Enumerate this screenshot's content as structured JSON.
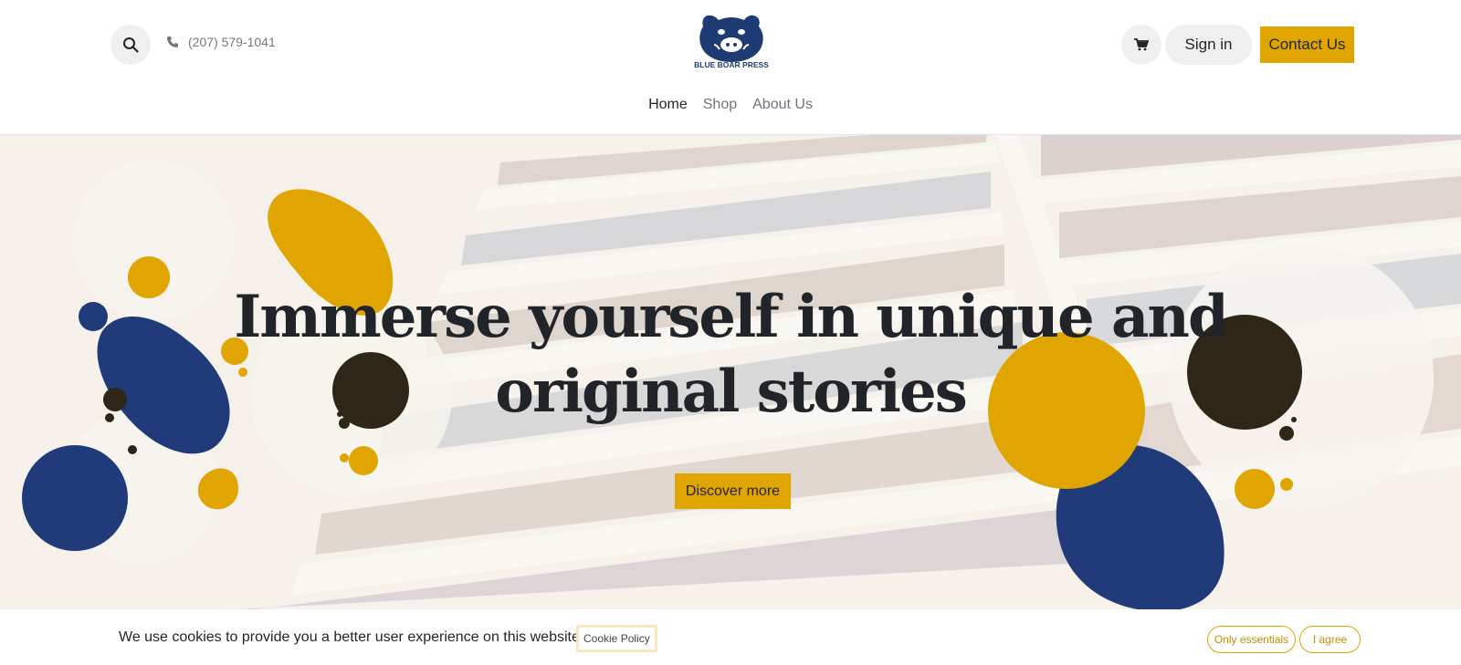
{
  "header": {
    "phone": "(207) 579-1041",
    "logo_text": "BLUE BOAR PRESS",
    "signin_label": "Sign in",
    "contact_label": "Contact Us",
    "icons": {
      "search": "search-icon",
      "phone": "phone-icon",
      "cart": "cart-icon"
    }
  },
  "nav": {
    "items": [
      {
        "label": "Home",
        "active": true
      },
      {
        "label": "Shop",
        "active": false
      },
      {
        "label": "About Us",
        "active": false
      }
    ]
  },
  "hero": {
    "title": "Immerse yourself in unique and original stories",
    "button_label": "Discover more"
  },
  "cookie": {
    "message": "We use cookies to provide you a better user experience on this website.",
    "policy_label": "Cookie Policy",
    "only_essentials_label": "Only essentials",
    "agree_label": "I agree"
  },
  "colors": {
    "accent_yellow": "#e0a500",
    "brand_blue": "#1f3b73",
    "shape_navy": "#213a7a",
    "shape_dark": "#2e2616"
  }
}
